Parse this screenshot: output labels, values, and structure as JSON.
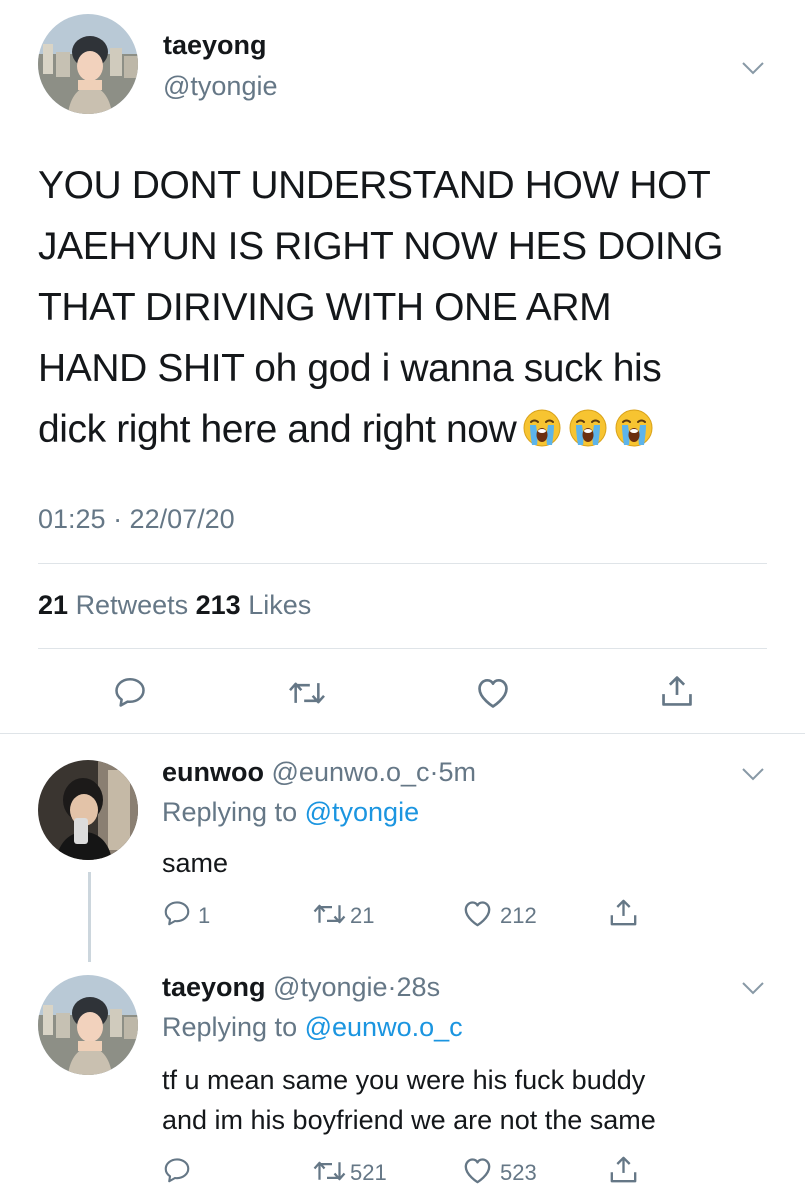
{
  "main_tweet": {
    "name": "taeyong",
    "handle": "@tyongie",
    "text_lines": [
      "YOU DONT UNDERSTAND HOW HOT",
      "JAEHYUN IS RIGHT NOW HES DOING",
      "THAT DIRIVING WITH ONE ARM",
      "HAND SHIT oh god i wanna suck his",
      "dick right here and right now"
    ],
    "emojis": [
      "loudly-crying-face",
      "loudly-crying-face",
      "loudly-crying-face"
    ],
    "timestamp": "01:25 · 22/07/20",
    "retweets_count": "21",
    "retweets_label": "Retweets",
    "likes_count": "213",
    "likes_label": "Likes"
  },
  "replies": [
    {
      "name": "eunwoo",
      "handle": "@eunwo.o_c",
      "sep": "·",
      "time": "5m",
      "replying_prefix": "Replying to",
      "replying_to": "@tyongie",
      "text_lines": [
        "same"
      ],
      "reply_count": "1",
      "retweet_count": "21",
      "like_count": "212"
    },
    {
      "name": "taeyong",
      "handle": "@tyongie",
      "sep": "·",
      "time": "28s",
      "replying_prefix": "Replying to",
      "replying_to": "@eunwo.o_c",
      "text_lines": [
        "tf u mean same you were his fuck buddy",
        "and im his boyfriend we are not the same"
      ],
      "reply_count": "",
      "retweet_count": "521",
      "like_count": "523"
    }
  ],
  "icons": {
    "reply": "speech-bubble-icon",
    "retweet": "retweet-icon",
    "like": "heart-icon",
    "share": "share-icon",
    "more": "chevron-down-icon"
  },
  "colors": {
    "text": "#14171a",
    "muted": "#657786",
    "link": "#1b95e0",
    "divider": "#dfe4e8"
  }
}
